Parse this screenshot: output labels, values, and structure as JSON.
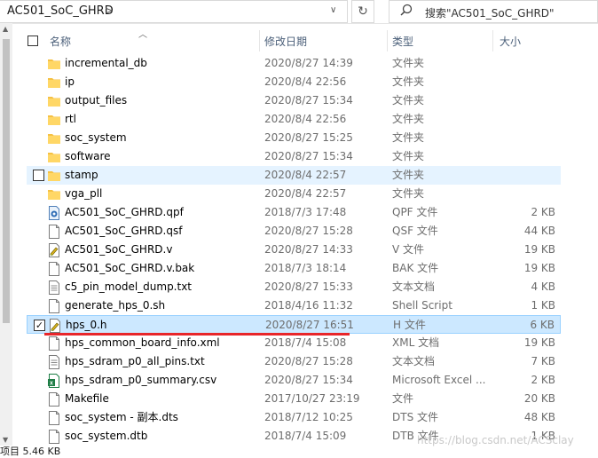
{
  "address": {
    "path": "AC501_SoC_GHRD",
    "sep": ">",
    "dropdown": "∨",
    "refresh": "↻"
  },
  "search": {
    "placeholder": "搜索\"AC501_SoC_GHRD\""
  },
  "columns": {
    "name": "名称",
    "date": "修改日期",
    "type": "类型",
    "size": "大小"
  },
  "files": [
    {
      "name": "incremental_db",
      "date": "2020/8/27 14:39",
      "type": "文件夹",
      "size": "",
      "icon": "folder-icon"
    },
    {
      "name": "ip",
      "date": "2020/8/4 22:56",
      "type": "文件夹",
      "size": "",
      "icon": "folder-icon"
    },
    {
      "name": "output_files",
      "date": "2020/8/27 15:34",
      "type": "文件夹",
      "size": "",
      "icon": "folder-icon"
    },
    {
      "name": "rtl",
      "date": "2020/8/4 22:56",
      "type": "文件夹",
      "size": "",
      "icon": "folder-icon"
    },
    {
      "name": "soc_system",
      "date": "2020/8/27 15:25",
      "type": "文件夹",
      "size": "",
      "icon": "folder-icon"
    },
    {
      "name": "software",
      "date": "2020/8/27 15:34",
      "type": "文件夹",
      "size": "",
      "icon": "folder-icon"
    },
    {
      "name": "stamp",
      "date": "2020/8/4 22:57",
      "type": "文件夹",
      "size": "",
      "icon": "folder-icon"
    },
    {
      "name": "vga_pll",
      "date": "2020/8/4 22:57",
      "type": "文件夹",
      "size": "",
      "icon": "folder-icon"
    },
    {
      "name": "AC501_SoC_GHRD.qpf",
      "date": "2018/7/3 17:48",
      "type": "QPF 文件",
      "size": "2 KB",
      "icon": "quartus-project-icon"
    },
    {
      "name": "AC501_SoC_GHRD.qsf",
      "date": "2020/8/27 15:28",
      "type": "QSF 文件",
      "size": "44 KB",
      "icon": "file-icon"
    },
    {
      "name": "AC501_SoC_GHRD.v",
      "date": "2020/8/27 14:33",
      "type": "V 文件",
      "size": "19 KB",
      "icon": "edit-file-icon"
    },
    {
      "name": "AC501_SoC_GHRD.v.bak",
      "date": "2018/7/3 18:14",
      "type": "BAK 文件",
      "size": "19 KB",
      "icon": "file-icon"
    },
    {
      "name": "c5_pin_model_dump.txt",
      "date": "2020/8/27 15:33",
      "type": "文本文档",
      "size": "4 KB",
      "icon": "text-file-icon"
    },
    {
      "name": "generate_hps_0.sh",
      "date": "2018/4/16 11:32",
      "type": "Shell Script",
      "size": "1 KB",
      "icon": "file-icon"
    },
    {
      "name": "hps_0.h",
      "date": "2020/8/27 16:51",
      "type": "H 文件",
      "size": "6 KB",
      "icon": "edit-file-icon"
    },
    {
      "name": "hps_common_board_info.xml",
      "date": "2018/7/4 15:08",
      "type": "XML 文档",
      "size": "19 KB",
      "icon": "file-icon"
    },
    {
      "name": "hps_sdram_p0_all_pins.txt",
      "date": "2020/8/27 15:28",
      "type": "文本文档",
      "size": "7 KB",
      "icon": "text-file-icon"
    },
    {
      "name": "hps_sdram_p0_summary.csv",
      "date": "2020/8/27 15:34",
      "type": "Microsoft Excel ...",
      "size": "2 KB",
      "icon": "excel-file-icon"
    },
    {
      "name": "Makefile",
      "date": "2017/10/27 23:19",
      "type": "文件",
      "size": "20 KB",
      "icon": "file-icon"
    },
    {
      "name": "soc_system - 副本.dts",
      "date": "2018/7/12 10:25",
      "type": "DTS 文件",
      "size": "48 KB",
      "icon": "file-icon"
    },
    {
      "name": "soc_system.dtb",
      "date": "2018/7/4 15:09",
      "type": "DTB 文件",
      "size": "1 KB",
      "icon": "file-icon"
    }
  ],
  "status": {
    "text": "项目  5.46 KB"
  },
  "watermark": "https://blog.csdn.net/ACSclay",
  "colors": {
    "hover": "#e5f3ff",
    "selected": "#cce8ff",
    "folder": "#f5c144",
    "underline": "#e8262a"
  }
}
